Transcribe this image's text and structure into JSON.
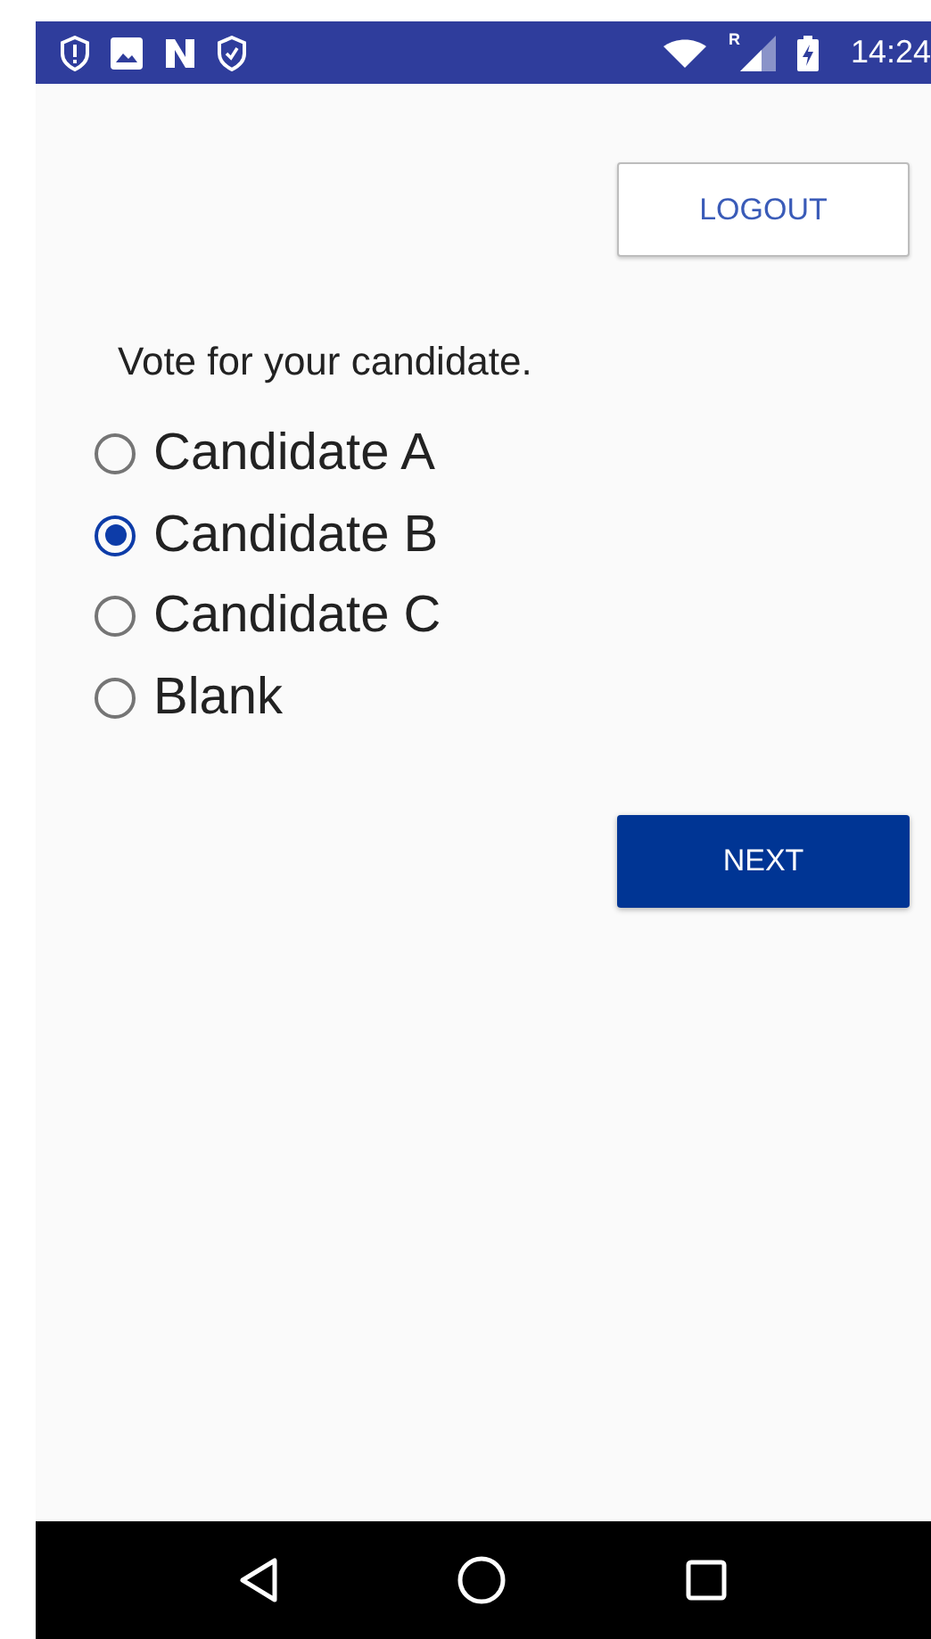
{
  "status_bar": {
    "roaming_label": "R",
    "time": "14:24"
  },
  "logout_button": {
    "label": "LOGOUT"
  },
  "prompt": "Vote for your candidate.",
  "options": [
    {
      "label": "Candidate A",
      "selected": false
    },
    {
      "label": "Candidate B",
      "selected": true
    },
    {
      "label": "Candidate C",
      "selected": false
    },
    {
      "label": "Blank",
      "selected": false
    }
  ],
  "next_button": {
    "label": "NEXT"
  }
}
